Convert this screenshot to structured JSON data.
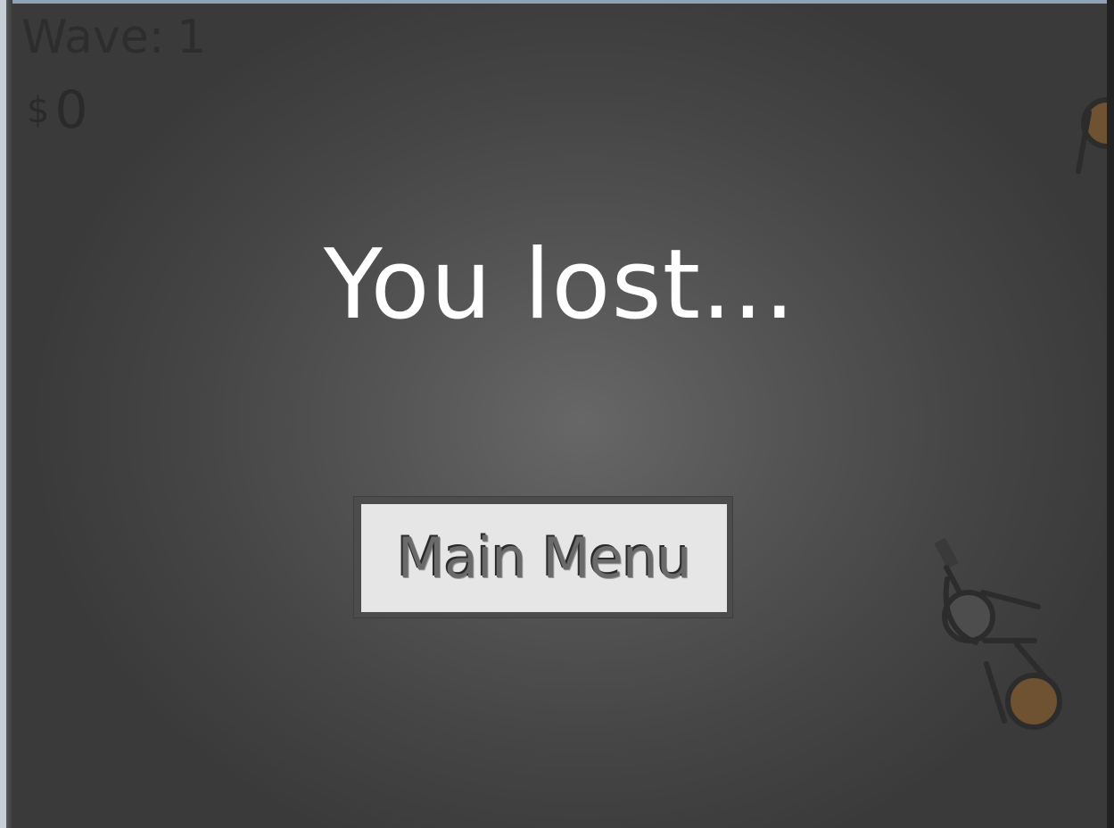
{
  "hud": {
    "wave_label": "Wave:",
    "wave_value": "1",
    "money_symbol": "$",
    "money_value": "0"
  },
  "overlay": {
    "title": "You lost...",
    "button_label": "Main Menu"
  },
  "colors": {
    "title_text": "#ffffff",
    "button_bg": "#e6e6e6",
    "unit_orange": "#6e5232",
    "unit_gray": "#4a4a4a",
    "outline": "#2c2c2c"
  }
}
